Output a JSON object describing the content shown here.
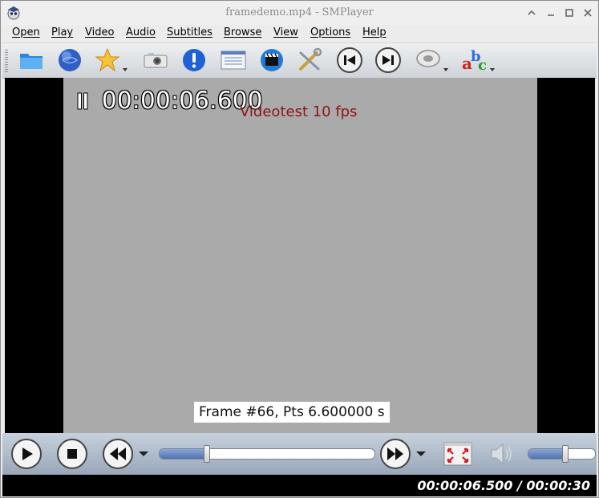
{
  "window": {
    "title": "framedemo.mp4 - SMPlayer"
  },
  "menu": [
    {
      "label": "Open"
    },
    {
      "label": "Play"
    },
    {
      "label": "Video"
    },
    {
      "label": "Audio"
    },
    {
      "label": "Subtitles"
    },
    {
      "label": "Browse"
    },
    {
      "label": "View"
    },
    {
      "label": "Options"
    },
    {
      "label": "Help"
    }
  ],
  "toolbar": {
    "icons": [
      "open-folder-icon",
      "open-url-globe-icon",
      "favorites-star-icon",
      "screenshot-camera-icon",
      "info-icon",
      "playlist-icon",
      "video-clapper-icon",
      "preferences-tools-icon",
      "previous-icon",
      "next-icon",
      "audio-disc-icon",
      "subtitles-abc-icon"
    ]
  },
  "video": {
    "osd_time": "00:00:06.600",
    "overlay_title": "Videotest 10 fps",
    "frame_label": "Frame #66, Pts 6.600000 s"
  },
  "controls": {
    "seek_progress": 0.22,
    "volume_level": 0.55
  },
  "status": {
    "time": "00:00:06.500 / 00:00:30"
  },
  "colors": {
    "video_bg": "#aaaaaa",
    "overlay_title": "#8d1515",
    "accent_fill": "#4f74b2"
  }
}
